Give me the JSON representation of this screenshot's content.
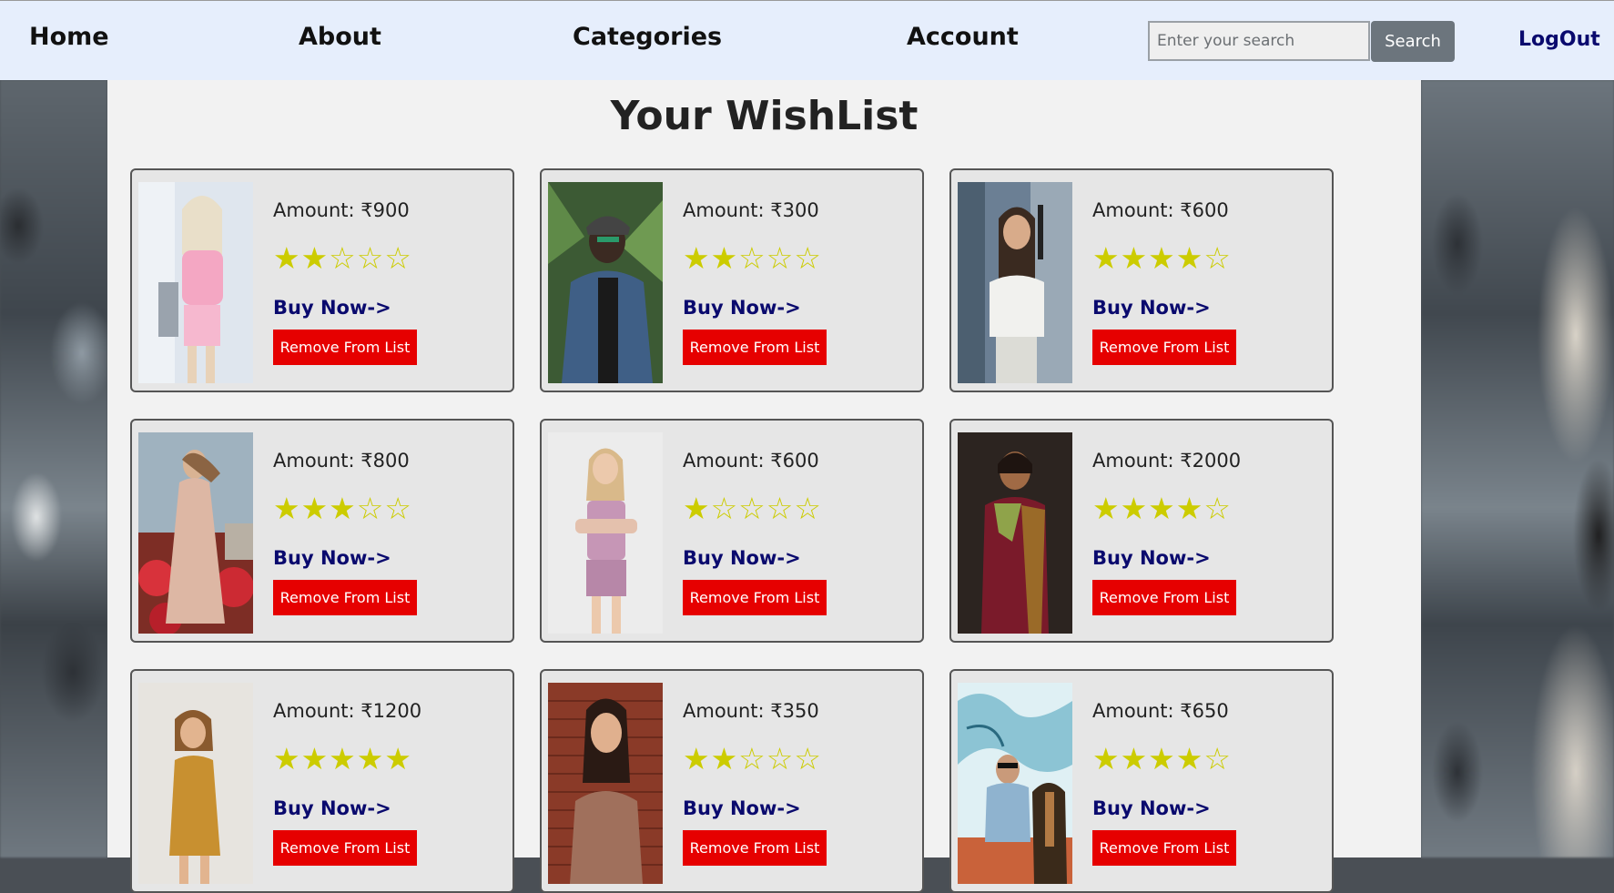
{
  "nav": {
    "home": "Home",
    "about": "About",
    "categories": "Categories",
    "account": "Account",
    "search_placeholder": "Enter your search",
    "search_button": "Search",
    "logout": "LogOut"
  },
  "page": {
    "title": "Your WishList"
  },
  "items": [
    {
      "amount": "Amount: ₹900",
      "rating": 2,
      "stars": "★★☆☆☆",
      "buy": "Buy Now->",
      "remove": "Remove From List"
    },
    {
      "amount": "Amount: ₹300",
      "rating": 2,
      "stars": "★★☆☆☆",
      "buy": "Buy Now->",
      "remove": "Remove From List"
    },
    {
      "amount": "Amount: ₹600",
      "rating": 4,
      "stars": "★★★★☆",
      "buy": "Buy Now->",
      "remove": "Remove From List"
    },
    {
      "amount": "Amount: ₹800",
      "rating": 3,
      "stars": "★★★☆☆",
      "buy": "Buy Now->",
      "remove": "Remove From List"
    },
    {
      "amount": "Amount: ₹600",
      "rating": 1,
      "stars": "★☆☆☆☆",
      "buy": "Buy Now->",
      "remove": "Remove From List"
    },
    {
      "amount": "Amount: ₹2000",
      "rating": 4,
      "stars": "★★★★☆",
      "buy": "Buy Now->",
      "remove": "Remove From List"
    },
    {
      "amount": "Amount: ₹1200",
      "rating": 5,
      "stars": "★★★★★",
      "buy": "Buy Now->",
      "remove": "Remove From List"
    },
    {
      "amount": "Amount: ₹350",
      "rating": 2,
      "stars": "★★☆☆☆",
      "buy": "Buy Now->",
      "remove": "Remove From List"
    },
    {
      "amount": "Amount: ₹650",
      "rating": 4,
      "stars": "★★★★☆",
      "buy": "Buy Now->",
      "remove": "Remove From List"
    }
  ],
  "colors": {
    "nav_bg": "#e6eefc",
    "buy_link": "#0a0a6e",
    "remove_button": "#e60000",
    "star": "#cccc00",
    "search_button": "#6c757d"
  }
}
